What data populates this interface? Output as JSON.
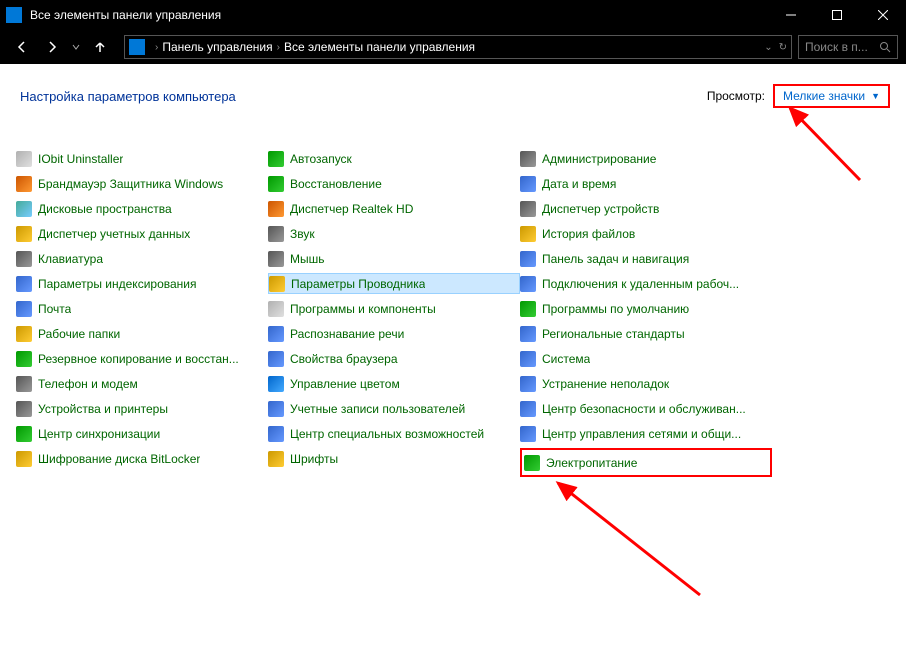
{
  "titlebar": {
    "title": "Все элементы панели управления"
  },
  "breadcrumb": {
    "seg1": "Панель управления",
    "seg2": "Все элементы панели управления"
  },
  "search": {
    "placeholder": "Поиск в п..."
  },
  "header": {
    "title": "Настройка параметров компьютера",
    "view_label": "Просмотр:",
    "view_value": "Мелкие значки"
  },
  "items": [
    {
      "label": "IObit Uninstaller",
      "ic": "ic1"
    },
    {
      "label": "Автозапуск",
      "ic": "ic5"
    },
    {
      "label": "Администрирование",
      "ic": "ic8"
    },
    {
      "label": "Брандмауэр Защитника Windows",
      "ic": "ic2"
    },
    {
      "label": "Восстановление",
      "ic": "ic5"
    },
    {
      "label": "Дата и время",
      "ic": "ic4"
    },
    {
      "label": "Дисковые пространства",
      "ic": "ic3"
    },
    {
      "label": "Диспетчер Realtek HD",
      "ic": "ic2"
    },
    {
      "label": "Диспетчер устройств",
      "ic": "ic8"
    },
    {
      "label": "Диспетчер учетных данных",
      "ic": "ic6"
    },
    {
      "label": "Звук",
      "ic": "ic8"
    },
    {
      "label": "История файлов",
      "ic": "ic6"
    },
    {
      "label": "Клавиатура",
      "ic": "ic8"
    },
    {
      "label": "Мышь",
      "ic": "ic8"
    },
    {
      "label": "Панель задач и навигация",
      "ic": "ic4"
    },
    {
      "label": "Параметры индексирования",
      "ic": "ic4"
    },
    {
      "label": "Параметры Проводника",
      "ic": "ic6",
      "hovered": true
    },
    {
      "label": "Подключения к удаленным рабоч...",
      "ic": "ic4"
    },
    {
      "label": "Почта",
      "ic": "ic4"
    },
    {
      "label": "Программы и компоненты",
      "ic": "ic1"
    },
    {
      "label": "Программы по умолчанию",
      "ic": "ic5"
    },
    {
      "label": "Рабочие папки",
      "ic": "ic6"
    },
    {
      "label": "Распознавание речи",
      "ic": "ic4"
    },
    {
      "label": "Региональные стандарты",
      "ic": "ic4"
    },
    {
      "label": "Резервное копирование и восстан...",
      "ic": "ic5"
    },
    {
      "label": "Свойства браузера",
      "ic": "ic4"
    },
    {
      "label": "Система",
      "ic": "ic4"
    },
    {
      "label": "Телефон и модем",
      "ic": "ic8"
    },
    {
      "label": "Управление цветом",
      "ic": "ic9"
    },
    {
      "label": "Устранение неполадок",
      "ic": "ic4"
    },
    {
      "label": "Устройства и принтеры",
      "ic": "ic8"
    },
    {
      "label": "Учетные записи пользователей",
      "ic": "ic4"
    },
    {
      "label": "Центр безопасности и обслуживан...",
      "ic": "ic4"
    },
    {
      "label": "Центр синхронизации",
      "ic": "ic5"
    },
    {
      "label": "Центр специальных возможностей",
      "ic": "ic4"
    },
    {
      "label": "Центр управления сетями и общи...",
      "ic": "ic4"
    },
    {
      "label": "Шифрование диска BitLocker",
      "ic": "ic6"
    },
    {
      "label": "Шрифты",
      "ic": "ic6"
    },
    {
      "label": "Электропитание",
      "ic": "ic5",
      "highlight": true
    }
  ]
}
